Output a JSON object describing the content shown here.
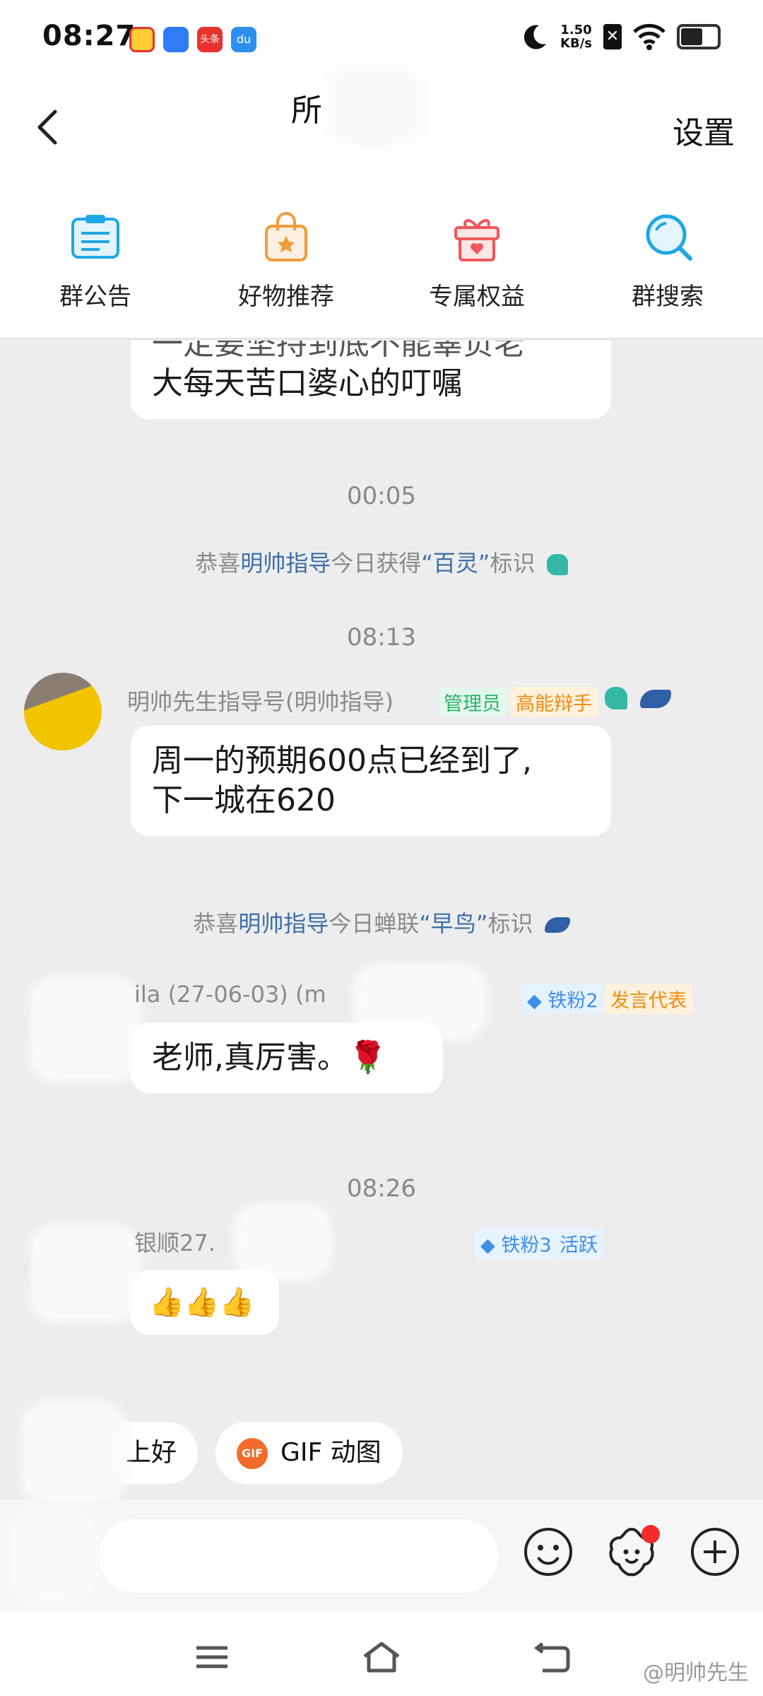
{
  "status_bar": {
    "time": "08:27",
    "net_speed_value": "1.50",
    "net_speed_unit": "KB/s",
    "app_icons": [
      "weibo-icon",
      "app-icon",
      "toutiao-icon",
      "du-icon"
    ],
    "toutiao_label": "头条",
    "du_label": "du"
  },
  "header": {
    "title": "所",
    "settings_label": "设置"
  },
  "quick_actions": [
    {
      "label": "群公告",
      "icon": "notice-icon",
      "color": "#1ea7e5"
    },
    {
      "label": "好物推荐",
      "icon": "shopping-bag-icon",
      "color": "#f39a3a"
    },
    {
      "label": "专属权益",
      "icon": "gift-icon",
      "color": "#f0565b"
    },
    {
      "label": "群搜索",
      "icon": "search-icon",
      "color": "#1ea7e5"
    }
  ],
  "chat": {
    "partial_bubble_line1": "一定要坚持到底不能辜负老",
    "partial_bubble_line2": "大每天苦口婆心的叮嘱",
    "ts1": "00:05",
    "sys1": {
      "prefix": "恭喜",
      "name": "明帅指导",
      "mid": "今日获得",
      "title": "“百灵”",
      "suffix": "标识"
    },
    "ts2": "08:13",
    "msg1": {
      "sender": "明帅先生指导号(明帅指导)",
      "badge_admin": "管理员",
      "badge_debater": "高能辩手",
      "line1": "周一的预期600点已经到了,",
      "line2": "下一城在620"
    },
    "sys2": {
      "prefix": "恭喜",
      "name": "明帅指导",
      "mid": "今日蝉联",
      "title": "“早鸟”",
      "suffix": "标识"
    },
    "msg2": {
      "sender": "ila (27-06-03) (m",
      "badge_fan": "铁粉2",
      "badge_speaker": "发言代表",
      "text": "老师,真厉害。🌹"
    },
    "ts3": "08:26",
    "msg3": {
      "sender": "银顺27.",
      "badge_fan": "铁粉3",
      "badge_active": "活跃",
      "text": "👍👍👍"
    }
  },
  "quick_replies": {
    "chip1": "上好",
    "chip2": "GIF 动图",
    "gif_badge": "GIF"
  },
  "watermark": "@明帅先生",
  "colors": {
    "accent_blue": "#3d6fa8",
    "admin_green": "#2bb36a",
    "orange": "#f08a12"
  }
}
